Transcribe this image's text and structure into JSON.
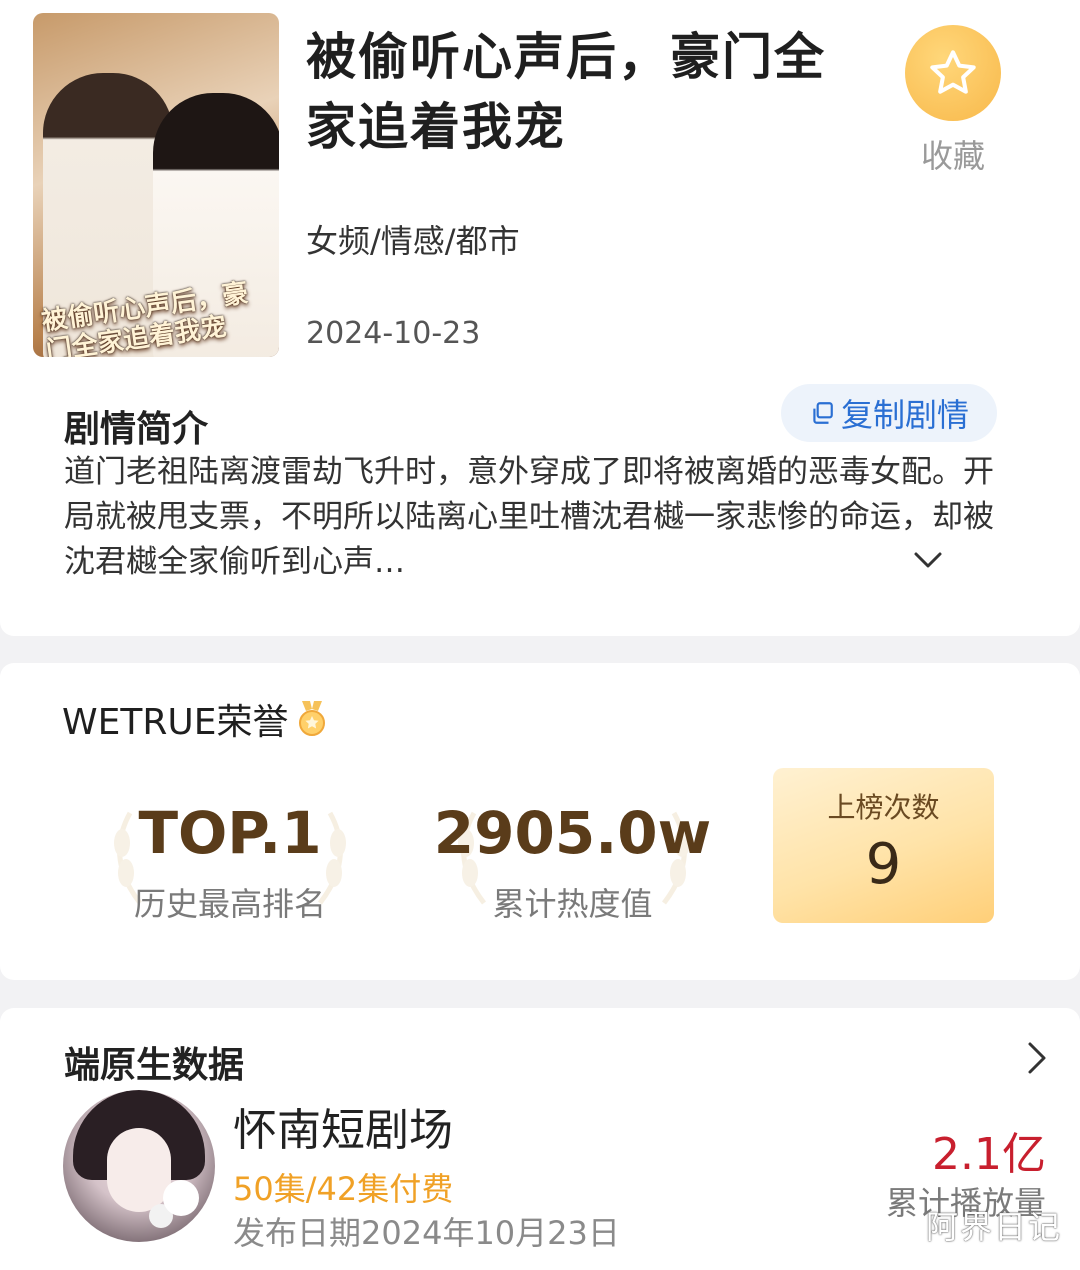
{
  "drama": {
    "title": "被偷听心声后，豪门全家追着我宠",
    "poster_text": "被偷听心声后，豪门全家追着我宠",
    "favorite_label": "收藏",
    "genre": "女频/情感/都市",
    "date": "2024-10-23",
    "synopsis_heading": "剧情简介",
    "copy_label": "复制剧情",
    "synopsis": "道门老祖陆离渡雷劫飞升时，意外穿成了即将被离婚的恶毒女配。开局就被甩支票，不明所以陆离心里吐槽沈君樾一家悲惨的命运，却被沈君樾全家偷听到心声…"
  },
  "honor": {
    "title": "WETRUE荣誉",
    "top_rank_value": "TOP.1",
    "top_rank_label": "历史最高排名",
    "heat_value": "2905.0w",
    "heat_label": "累计热度值",
    "chart_count_label": "上榜次数",
    "chart_count_value": "9"
  },
  "native": {
    "title": "端原生数据",
    "channel_name": "怀南短剧场",
    "episodes": "50集/42集付费",
    "publish_date": "发布日期2024年10月23日",
    "plays_value": "2.1亿",
    "plays_label": "累计播放量"
  },
  "watermark": "阿界日记",
  "colors": {
    "accent_blue": "#2a6fd3",
    "favorite_gold": "#f8b84a",
    "episodes_orange": "#f0a126",
    "plays_red": "#c81f2e",
    "stat_brown": "#5a3c1a"
  },
  "icons": [
    "star-icon",
    "copy-icon",
    "chevron-down-icon",
    "medal-icon",
    "laurel-icon",
    "chevron-right-icon"
  ]
}
